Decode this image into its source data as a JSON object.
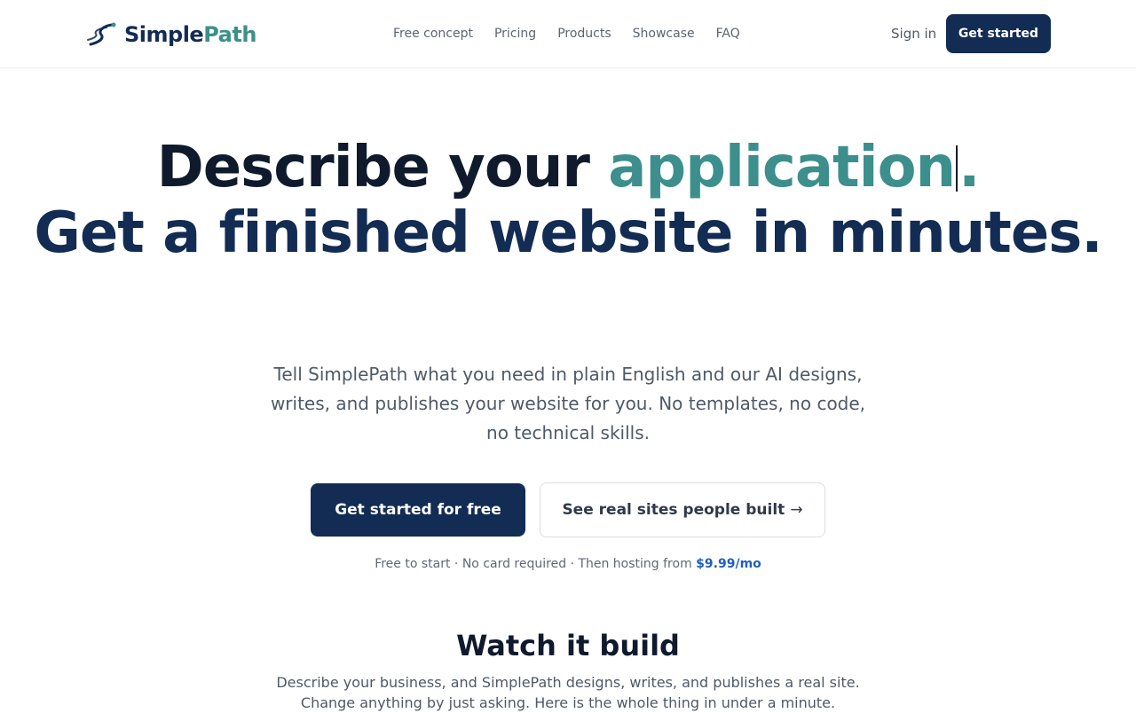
{
  "brand": {
    "name_part1": "Simple",
    "name_part2": "Path",
    "colors": {
      "navy": "#132c53",
      "teal": "#3c8f8c",
      "link_blue": "#1f5fbf"
    }
  },
  "nav": {
    "links": [
      "Free concept",
      "Pricing",
      "Products",
      "Showcase",
      "FAQ"
    ],
    "sign_in": "Sign in",
    "cta": "Get started"
  },
  "hero": {
    "line1_prefix": "Describe your",
    "line1_accent": "application",
    "line1_suffix": ".",
    "line2": "Get a finished website in minutes.",
    "subtitle": "Tell SimplePath what you need in plain English and our AI designs, writes, and publishes your website for you. No templates, no code, no technical skills.",
    "primary_cta": "Get started for free",
    "secondary_cta": "See real sites people built",
    "secondary_arrow": "→",
    "fineprint_prefix": "Free to start · No card required · Then hosting from",
    "fineprint_price": "$9.99/mo"
  },
  "watch": {
    "title": "Watch it build",
    "subtitle": "Describe your business, and SimplePath designs, writes, and publishes a real site. Change anything by just asking. Here is the whole thing in under a minute."
  },
  "icons": {
    "logo": "stylized-path-s-icon"
  }
}
